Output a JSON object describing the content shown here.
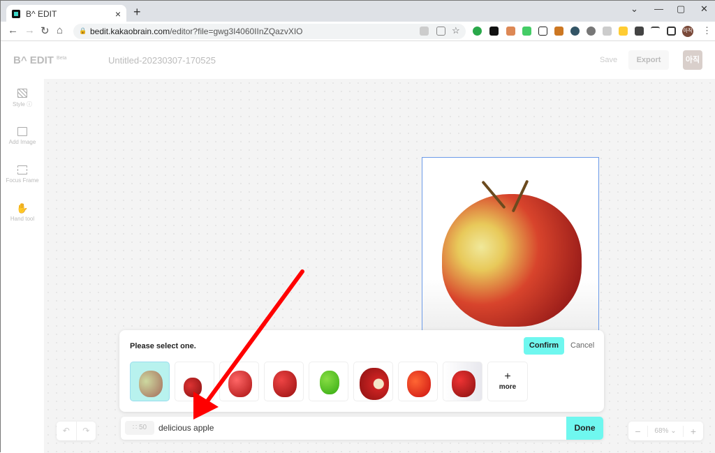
{
  "browser": {
    "tab_title": "B^ EDIT",
    "url_domain": "bedit.kakaobrain.com",
    "url_path": "/editor?file=gwg3I4060IInZQazvXIO",
    "profile_initials": "아직"
  },
  "app": {
    "logo": "B^ EDIT",
    "logo_badge": "Beta",
    "doc_title": "Untitled-20230307-170525",
    "save_label": "Save",
    "export_label": "Export",
    "user_label": "아직"
  },
  "sidebar": {
    "items": [
      {
        "label": "Style ⓘ",
        "icon": "style-icon"
      },
      {
        "label": "Add Image",
        "icon": "image-icon"
      },
      {
        "label": "Focus Frame",
        "icon": "frame-icon"
      },
      {
        "label": "Hand tool",
        "icon": "hand-icon"
      }
    ]
  },
  "panel": {
    "prompt": "Please select one.",
    "confirm_label": "Confirm",
    "cancel_label": "Cancel",
    "more_label": "more",
    "thumbnail_count": 8
  },
  "input": {
    "count": "50",
    "value": "delicious apple",
    "done_label": "Done"
  },
  "zoom": {
    "level": "68%"
  },
  "colors": {
    "accent": "#6ff7ef",
    "frame": "#6b9ae8",
    "arrow": "#ff0000"
  }
}
